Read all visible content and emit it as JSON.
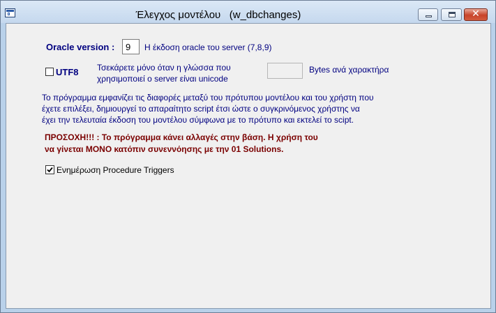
{
  "window": {
    "title": "Έλεγχος μοντέλου   (w_dbchanges)",
    "close_glyph": "✕"
  },
  "oracle": {
    "label": "Oracle version :",
    "value": "9",
    "hint": "Η έκδοση oracle του server (7,8,9)"
  },
  "utf8": {
    "label": "UTF8",
    "checked": false,
    "hint_lines": [
      "Τσεκάρετε μόνο όταν η γλώσσα που",
      "χρησιμοποιεί ο server είναι unicode"
    ],
    "bytes_value": "",
    "bytes_label": "Bytes ανά χαρακτήρα"
  },
  "description_lines": [
    "Το πρόγραμμα εμφανίζει τις διαφορές μεταξύ του πρότυπου μοντέλου και του χρήστη που",
    "έχετε επιλέξει, δημιουργεί το απαραίτητο script έτσι ώστε ο συγκρινόμενος χρήστης  να",
    "έχει την τελευταία έκδοση του μοντέλου σύμφωνα με το πρότυπο και εκτελεί το scipt."
  ],
  "warning_lines": [
    "ΠΡΟΣΟΧΗ!!! : Το πρόγραμμα κάνει αλλαγές στην βάση. Η χρήση του",
    "να γίνεται ΜΟΝΟ κατόπιν συνεννόησης με την 01 Solutions."
  ],
  "triggers": {
    "label": "Ενημέρωση Procedure  Triggers",
    "checked": true
  },
  "colors": {
    "label_blue": "#000080",
    "warning_red": "#7a0000",
    "title_bar": "#c5d8ee",
    "client_bg": "#f0f0f0"
  }
}
